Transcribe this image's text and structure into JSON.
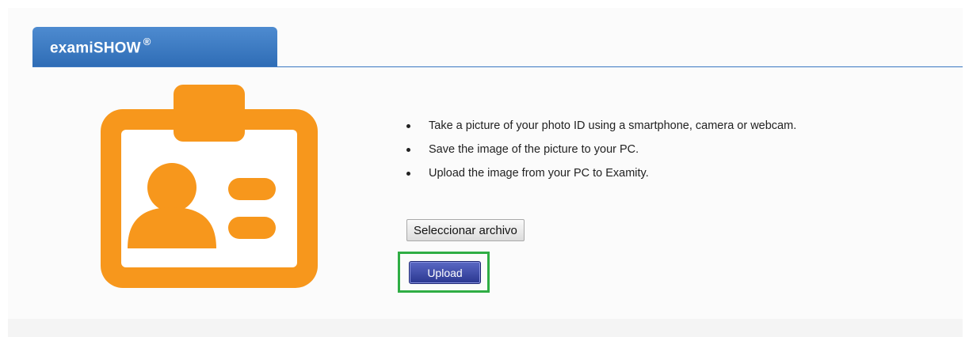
{
  "header": {
    "tab_title": "examiSHOW",
    "tab_mark": "®"
  },
  "instructions": [
    "Take a picture of your photo ID using a smartphone, camera or webcam.",
    "Save the image of the picture to your PC.",
    "Upload the image from your PC to Examity."
  ],
  "file_input": {
    "label": "Seleccionar archivo"
  },
  "upload": {
    "label": "Upload"
  },
  "icons": {
    "id_card": "id-card-icon"
  },
  "colors": {
    "tab_blue": "#3a78c4",
    "icon_orange": "#f7971c",
    "upload_button": "#2f3c99",
    "highlight_green": "#2fad44"
  }
}
